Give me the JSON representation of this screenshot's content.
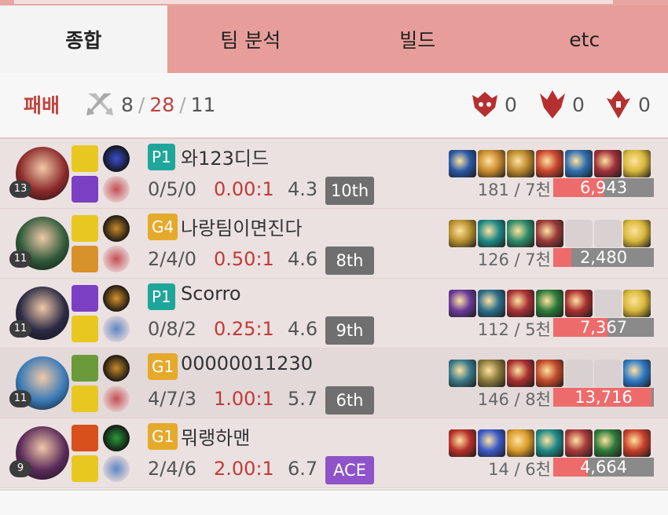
{
  "tabs": [
    {
      "label": "종합",
      "active": true
    },
    {
      "label": "팀 분석",
      "active": false
    },
    {
      "label": "빌드",
      "active": false
    },
    {
      "label": "etc",
      "active": false
    }
  ],
  "summary": {
    "result": "패배",
    "kills": "8",
    "deaths": "28",
    "assists": "11",
    "sep": "/",
    "towers": "0",
    "dragons": "0",
    "barons": "0"
  },
  "players": [
    {
      "tier": "P1",
      "tier_color": "p",
      "name": "와123디드",
      "level": "13",
      "kda": "0/5/0",
      "ratio": "0.00:1",
      "score": "4.3",
      "rank": "10th",
      "cs": "181 / 7천",
      "damage": "6,943",
      "damage_fraction": 0.5,
      "champ_color": "#8b2a2a",
      "spells": [
        "#e8c820",
        "#7b3fc4"
      ],
      "runes": [
        "#3a4fd0",
        "#c44f55"
      ],
      "items": [
        "#2a58a8",
        "#c98a2c",
        "#b8862c",
        "#c8452d",
        "#2f6eb0",
        "#a0303a",
        "#d8b83a"
      ]
    },
    {
      "tier": "G4",
      "tier_color": "g",
      "name": "나랑팀이면진다",
      "level": "11",
      "kda": "2/4/0",
      "ratio": "0.50:1",
      "score": "4.6",
      "rank": "8th",
      "cs": "126 / 7천",
      "damage": "2,480",
      "damage_fraction": 0.18,
      "champ_color": "#2f5a3a",
      "spells": [
        "#e8c820",
        "#d8922c"
      ],
      "runes": [
        "#c88a2a",
        "#c44f55"
      ],
      "items": [
        "#b8912e",
        "#1f8a86",
        "#2f8c6a",
        "#9a3a3a",
        "",
        "",
        "#d8b83a"
      ]
    },
    {
      "tier": "P1",
      "tier_color": "p",
      "name": "Scorro",
      "level": "11",
      "kda": "0/8/2",
      "ratio": "0.25:1",
      "score": "4.6",
      "rank": "9th",
      "cs": "112 / 5천",
      "damage": "7,367",
      "damage_fraction": 0.54,
      "champ_color": "#2a2a44",
      "spells": [
        "#7b3fc4",
        "#e8c820"
      ],
      "runes": [
        "#d8922c",
        "#5c86c4"
      ],
      "items": [
        "#6a3a9a",
        "#2b6e8a",
        "#a83236",
        "#2e7a3a",
        "#a82f2f",
        "",
        "#d8b83a"
      ]
    },
    {
      "tier": "G1",
      "tier_color": "g",
      "name": "00000011230",
      "level": "11",
      "kda": "4/7/3",
      "ratio": "1.00:1",
      "score": "5.7",
      "rank": "6th",
      "cs": "146 / 8천",
      "damage": "13,716",
      "damage_fraction": 0.98,
      "champ_color": "#3a7ab8",
      "spells": [
        "#6a9a3a",
        "#e8c820"
      ],
      "runes": [
        "#c88a2a",
        "#c44f55"
      ],
      "items": [
        "#3a7a8a",
        "#8a7a3a",
        "#a82f2f",
        "#c04a2a",
        "",
        "",
        "#2f7ac8"
      ]
    },
    {
      "tier": "G1",
      "tier_color": "g",
      "name": "뭐랭하맨",
      "level": "9",
      "kda": "2/4/6",
      "ratio": "2.00:1",
      "score": "6.7",
      "rank": "ACE",
      "cs": "14 / 6천",
      "damage": "4,664",
      "damage_fraction": 0.34,
      "champ_color": "#5a2a5a",
      "spells": [
        "#d8501c",
        "#e8c820"
      ],
      "runes": [
        "#2a9a3a",
        "#5c86c4"
      ],
      "items": [
        "#b8302a",
        "#3a5ac8",
        "#d89a2a",
        "#1f8a86",
        "#a83a3a",
        "#2e7a3a",
        "#c8402a"
      ]
    }
  ]
}
